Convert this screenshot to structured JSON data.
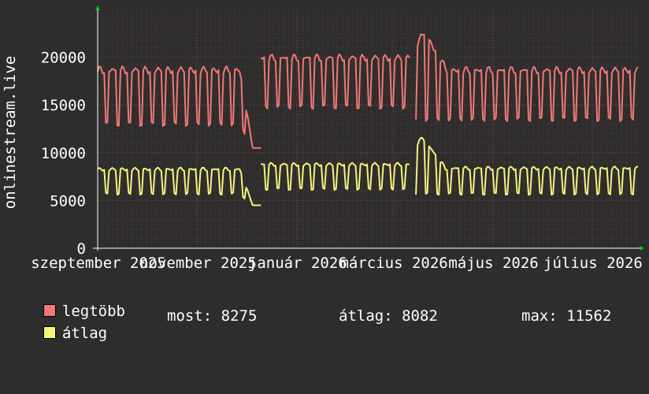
{
  "chart_data": {
    "type": "line",
    "ylabel": "onlinestream.live",
    "ylim": [
      0,
      25000
    ],
    "yticks": [
      0,
      5000,
      10000,
      15000,
      20000
    ],
    "x_tick_labels": [
      "szeptember 2025",
      "november 2025",
      "január 2026",
      "március 2026",
      "május 2026",
      "július 2026"
    ],
    "x_range_days": [
      0,
      331
    ],
    "x_tick_days": [
      0,
      61,
      122,
      181,
      242,
      303
    ],
    "grid": true,
    "legend_position": "bottom",
    "series": [
      {
        "name": "legtöbb",
        "color": "#f07878",
        "segments": [
          {
            "start_day": 0,
            "end_day": 95,
            "weekday": 18500,
            "weekend": 13000,
            "dip_day": 100,
            "dip_value": 10500
          },
          {
            "start_day": 100,
            "end_day": 191,
            "weekday": 19800,
            "weekend": 14800
          },
          {
            "start_day": 195,
            "end_day": 331,
            "weekday": 18500,
            "weekend": 13500
          }
        ],
        "peak": {
          "day": 200,
          "value": 22500
        }
      },
      {
        "name": "átlag",
        "color": "#f5f579",
        "segments": [
          {
            "start_day": 0,
            "end_day": 95,
            "weekday": 8200,
            "weekend": 5700,
            "dip_day": 100,
            "dip_value": 4500
          },
          {
            "start_day": 100,
            "end_day": 191,
            "weekday": 8700,
            "weekend": 6200
          },
          {
            "start_day": 195,
            "end_day": 331,
            "weekday": 8300,
            "weekend": 5700
          }
        ],
        "peak": {
          "day": 199,
          "value": 11562
        }
      }
    ]
  },
  "legend": {
    "max_label": "legtöbb",
    "max_color": "#f07878",
    "avg_label": "átlag",
    "avg_color": "#f5f579",
    "stat_current": "most: 8275",
    "stat_average": "átlag: 8082",
    "stat_max": "max: 11562"
  }
}
